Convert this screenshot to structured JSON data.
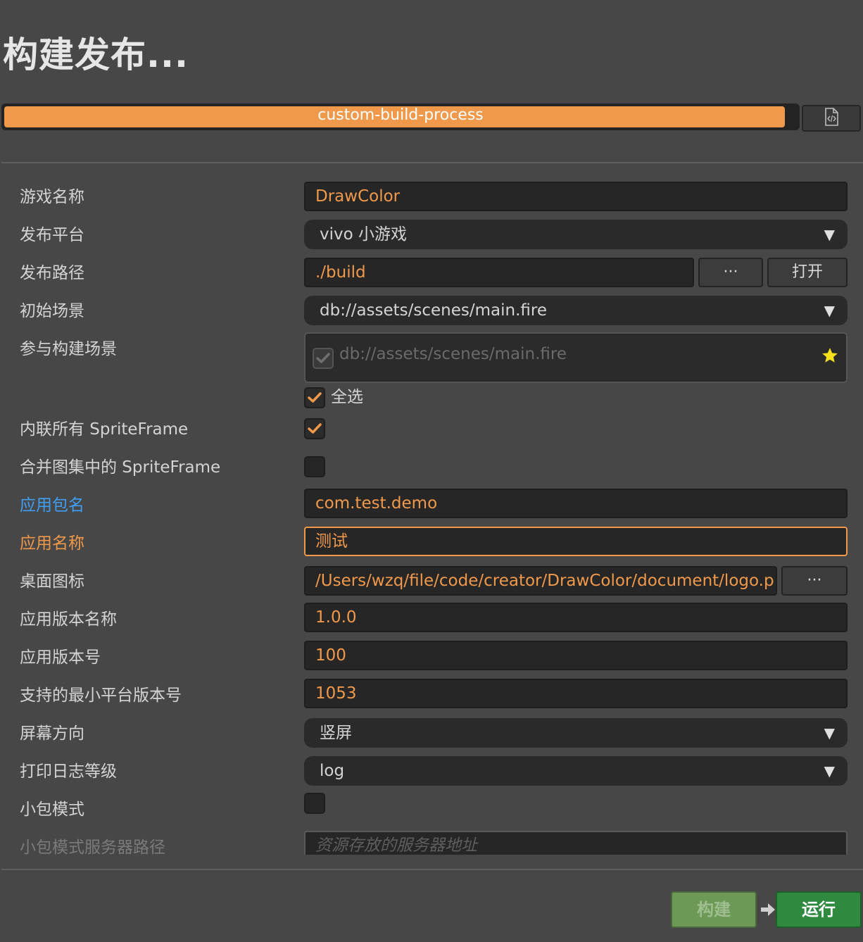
{
  "window": {
    "title": "构建发布..."
  },
  "progress": {
    "label": "custom-build-process",
    "value": 0.985
  },
  "form": {
    "game_name": {
      "label": "游戏名称",
      "value": "DrawColor"
    },
    "platform": {
      "label": "发布平台",
      "value": "vivo 小游戏"
    },
    "build_path": {
      "label": "发布路径",
      "value": "./build",
      "browse_label": "···",
      "open_label": "打开"
    },
    "start_scene": {
      "label": "初始场景",
      "value": "db://assets/scenes/main.fire"
    },
    "scenes": {
      "label": "参与构建场景",
      "items": [
        {
          "path": "db://assets/scenes/main.fire",
          "checked": true,
          "disabled": true,
          "starred": true
        }
      ],
      "select_all_label": "全选",
      "select_all_checked": true
    },
    "inline_spriteframe": {
      "label": "内联所有 SpriteFrame",
      "checked": true
    },
    "merge_spriteframe": {
      "label": "合并图集中的 SpriteFrame",
      "checked": false
    },
    "package_name": {
      "label": "应用包名",
      "value": "com.test.demo"
    },
    "app_name": {
      "label": "应用名称",
      "value": "测试"
    },
    "icon": {
      "label": "桌面图标",
      "value": "/Users/wzq/file/code/creator/DrawColor/document/logo.p",
      "browse_label": "···"
    },
    "version_name": {
      "label": "应用版本名称",
      "value": "1.0.0"
    },
    "version_number": {
      "label": "应用版本号",
      "value": "100"
    },
    "min_platform": {
      "label": "支持的最小平台版本号",
      "value": "1053"
    },
    "orientation": {
      "label": "屏幕方向",
      "value": "竖屏"
    },
    "log_level": {
      "label": "打印日志等级",
      "value": "log"
    },
    "subpackage": {
      "label": "小包模式",
      "checked": false
    },
    "subpackage_server": {
      "label": "小包模式服务器路径",
      "placeholder": "资源存放的服务器地址"
    }
  },
  "footer": {
    "build_label": "构建",
    "run_label": "运行"
  },
  "colors": {
    "accent": "#f0994a",
    "link_blue": "#3f9ef5",
    "build_green": "#6c9a56",
    "run_green": "#2f8a3f"
  },
  "icons": {
    "doc": "code-document-icon",
    "dropdown": "triangle-down-icon",
    "check": "checkmark-icon",
    "star": "star-icon",
    "arrow": "arrow-right-icon"
  }
}
